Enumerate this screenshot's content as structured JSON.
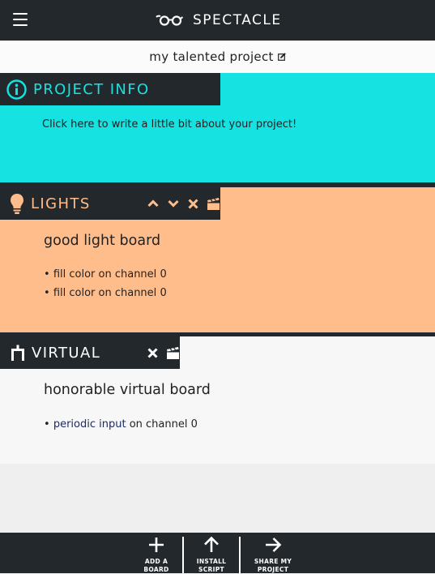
{
  "app": {
    "brand_name": "SPECTACLE",
    "colors": {
      "dark": "#22282b",
      "info": "#16e2e2",
      "lights": "#ffbd8c",
      "virtual": "#f7f7f7"
    }
  },
  "project": {
    "title": "my talented project",
    "edit_icon": "edit-icon"
  },
  "sections": {
    "info": {
      "title": "PROJECT INFO",
      "icon": "info-icon",
      "description": "Click here to write a little bit about your project!"
    },
    "lights": {
      "title": "LIGHTS",
      "icon": "lightbulb-icon",
      "actions": [
        "chevron-up-icon",
        "chevron-down-icon",
        "close-icon",
        "clapperboard-icon"
      ],
      "board_name": "good light board",
      "channels": [
        {
          "bullet": "•",
          "kind": "fill color",
          "on": "on channel",
          "number": "0"
        },
        {
          "bullet": "•",
          "kind": "fill color",
          "on": "on channel",
          "number": "0"
        }
      ]
    },
    "virtual": {
      "title": "VIRTUAL",
      "icon": "plug-icon",
      "actions": [
        "close-icon",
        "clapperboard-icon"
      ],
      "board_name": "honorable virtual board",
      "channels": [
        {
          "bullet": "•",
          "kind": "periodic input",
          "on": "on channel",
          "number": "0"
        }
      ]
    }
  },
  "bottom_bar": {
    "add_board": "ADD A\nBOARD",
    "install_script": "INSTALL\nSCRIPT",
    "share_project": "SHARE MY\nPROJECT"
  }
}
